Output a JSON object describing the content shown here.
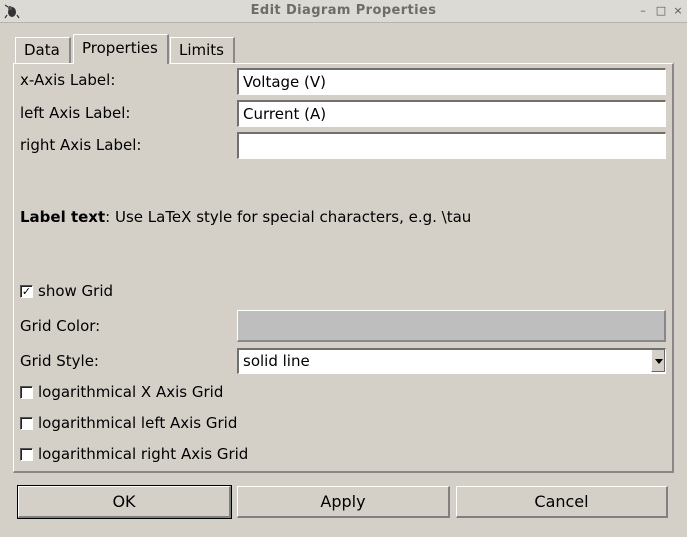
{
  "window": {
    "title": "Edit Diagram Properties",
    "min_glyph": "–",
    "max_glyph": "□",
    "close_glyph": "×"
  },
  "tabs": [
    {
      "label": "Data",
      "active": false
    },
    {
      "label": "Properties",
      "active": true
    },
    {
      "label": "Limits",
      "active": false
    }
  ],
  "properties": {
    "x_axis_label": {
      "label": "x-Axis Label:",
      "value": "Voltage (V)"
    },
    "left_axis_label": {
      "label": "left Axis Label:",
      "value": "Current (A)"
    },
    "right_axis_label": {
      "label": "right Axis Label:",
      "value": ""
    },
    "hint_bold": "Label text",
    "hint_text": ": Use LaTeX style for special characters, e.g. \\tau",
    "show_grid": {
      "label": "show Grid",
      "checked": true
    },
    "grid_color": {
      "label": "Grid Color:",
      "color": "#bebebe"
    },
    "grid_style": {
      "label": "Grid Style:",
      "value": "solid line"
    },
    "log_x": {
      "label": "logarithmical X Axis Grid",
      "checked": false
    },
    "log_left": {
      "label": "logarithmical left Axis Grid",
      "checked": false
    },
    "log_right": {
      "label": "logarithmical right Axis Grid",
      "checked": false
    }
  },
  "buttons": {
    "ok": "OK",
    "apply": "Apply",
    "cancel": "Cancel"
  },
  "check_mark": "✓"
}
